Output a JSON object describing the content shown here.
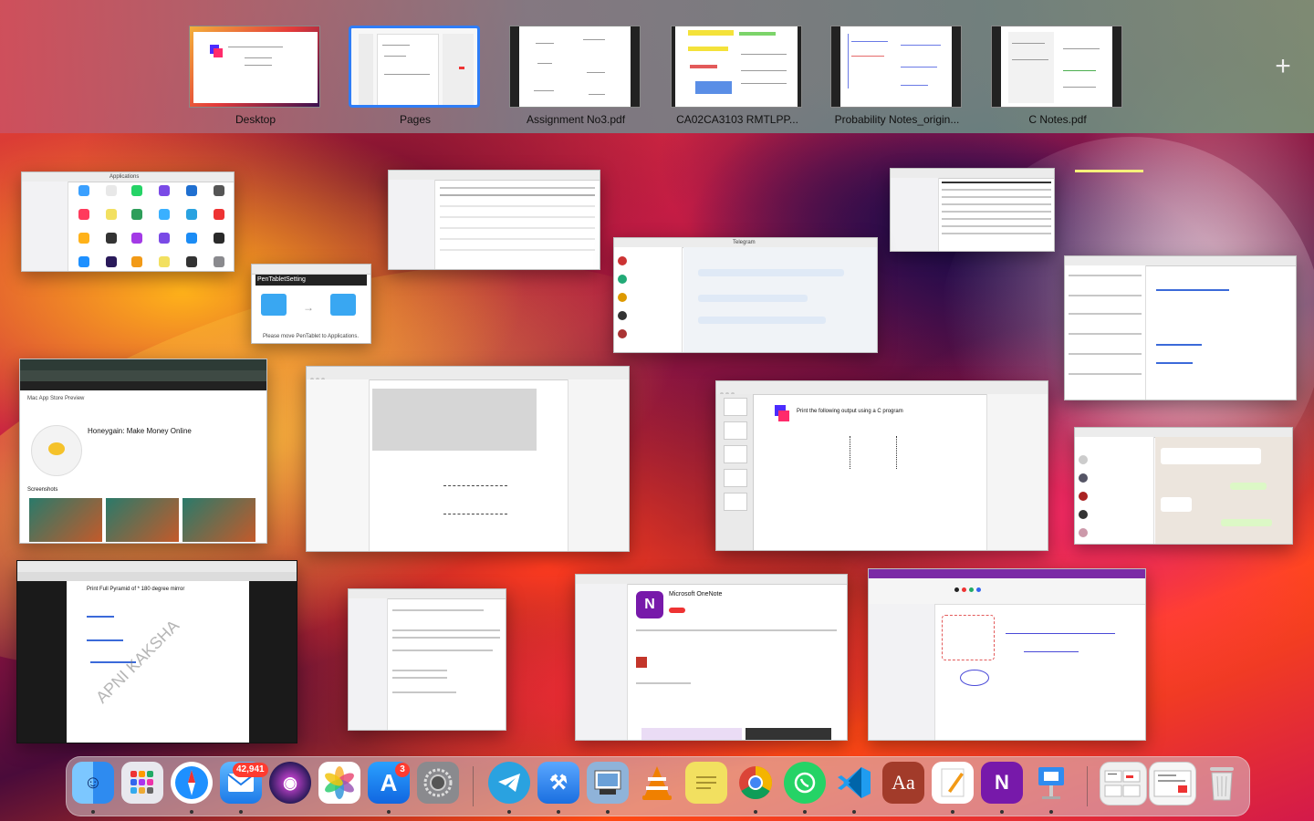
{
  "spaces": [
    {
      "label": "Desktop",
      "selected": false
    },
    {
      "label": "Pages",
      "selected": true
    },
    {
      "label": "Assignment No3.pdf",
      "selected": false
    },
    {
      "label": "CA02CA3103 RMTLPP...",
      "selected": false
    },
    {
      "label": "Probability Notes_origin...",
      "selected": false
    },
    {
      "label": "C Notes.pdf",
      "selected": false
    }
  ],
  "add_space_symbol": "+",
  "windows": {
    "finder_apps": {
      "title": "Applications"
    },
    "pentablet": {
      "title": "PenTabletSetting",
      "caption": "Please move PenTablet to Applications."
    },
    "telegram": {
      "title": "Telegram"
    },
    "appstore_web": {
      "title": "Mac App Store Preview",
      "app_name": "Honeygain: Make Money Online",
      "section": "Screenshots"
    },
    "pages_doc": {
      "heading": "Print the following output using a C program"
    },
    "c_pyramid": {
      "heading": "Print Full Pyramid of * 180 degree mirror",
      "watermark": "APNI KAKSHA"
    },
    "onenote_store": {
      "title": "Microsoft OneNote"
    }
  },
  "dock": {
    "items": [
      {
        "name": "finder-icon",
        "label": "Finder",
        "color": "#2e8bf0"
      },
      {
        "name": "launchpad-icon",
        "label": "Launchpad",
        "color": "#e8e8ee"
      },
      {
        "name": "safari-icon",
        "label": "Safari",
        "color": "#1e90ff"
      },
      {
        "name": "mail-icon",
        "label": "Mail",
        "color": "#3aa0ff",
        "badge": "42,941"
      },
      {
        "name": "siri-icon",
        "label": "Siri",
        "color": "#2a1a5a"
      },
      {
        "name": "photos-icon",
        "label": "Photos",
        "color": "#ffffff"
      },
      {
        "name": "app-store-icon",
        "label": "App Store",
        "color": "#1b8cf5",
        "badge": "3"
      },
      {
        "name": "system-preferences-icon",
        "label": "System Preferences",
        "color": "#8a8a8e"
      },
      {
        "name": "telegram-icon",
        "label": "Telegram",
        "color": "#2aa2e0"
      },
      {
        "name": "xcode-icon",
        "label": "Xcode",
        "color": "#1a6fe0"
      },
      {
        "name": "preview-icon",
        "label": "Preview",
        "color": "#8fb3d9"
      },
      {
        "name": "vlc-icon",
        "label": "VLC",
        "color": "#f08000"
      },
      {
        "name": "stickies-icon",
        "label": "Stickies",
        "color": "#f2e060"
      },
      {
        "name": "chrome-icon",
        "label": "Google Chrome",
        "color": "#ffffff"
      },
      {
        "name": "whatsapp-icon",
        "label": "WhatsApp",
        "color": "#25d366"
      },
      {
        "name": "vscode-icon",
        "label": "Visual Studio Code",
        "color": "#1f9cf0"
      },
      {
        "name": "dictionary-icon",
        "label": "Dictionary",
        "color": "#a23b2a",
        "text": "Aa"
      },
      {
        "name": "pages-icon",
        "label": "Pages",
        "color": "#f29a17"
      },
      {
        "name": "onenote-icon",
        "label": "OneNote",
        "color": "#7719aa",
        "text": "N"
      },
      {
        "name": "keynote-icon",
        "label": "Keynote",
        "color": "#2f8cf0"
      },
      {
        "name": "downloads-stack-icon",
        "label": "Downloads",
        "color": "#e6e6e6"
      },
      {
        "name": "trash-icon",
        "label": "Trash",
        "color": "#d8d8d8"
      }
    ]
  }
}
